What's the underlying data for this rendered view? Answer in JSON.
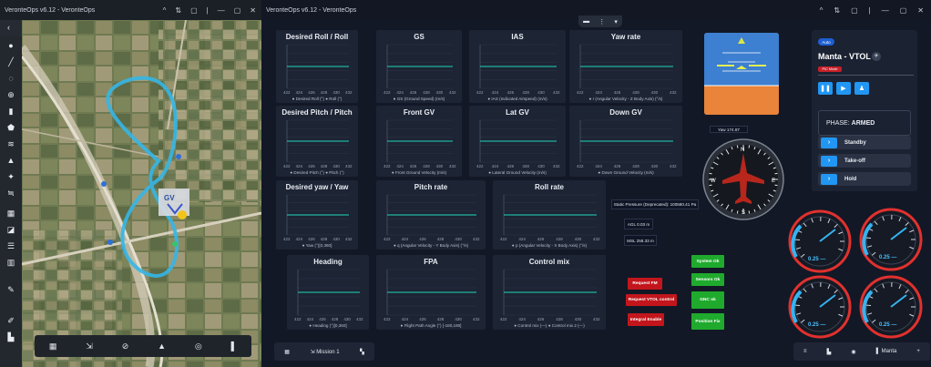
{
  "map_window": {
    "title": "VeronteOps v6.12 - VeronteOps",
    "controls": [
      "^",
      "⇅",
      "▢",
      "|",
      "—",
      "▢",
      "✕"
    ],
    "toolbar": [
      "‹",
      "▬",
      "⋮",
      "▾"
    ],
    "sidebar_icons": [
      "location-pin",
      "ruler",
      "lasso",
      "globe",
      "phone",
      "shape",
      "layers",
      "warning",
      "pin",
      "route",
      "grid",
      "edit",
      "list",
      "trash",
      "pencil",
      "pen",
      "bin"
    ],
    "bottombar": [
      "▦",
      "⇲",
      "⊘",
      "▲",
      "◎",
      "▌"
    ],
    "track_color": "#35b6e6"
  },
  "main_window": {
    "title": "VeronteOps v6.12 - VeronteOps",
    "controls": [
      "^",
      "⇅",
      "▢",
      "|",
      "—",
      "▢",
      "✕"
    ],
    "top_pill": [
      "▬",
      "⋮",
      "▾"
    ]
  },
  "panels": [
    {
      "title": "Desired Roll / Roll",
      "legend": [
        "Desired Roll (°)",
        "Roll (°)"
      ]
    },
    {
      "title": "GS",
      "legend": [
        "GS (Ground Speed) (m/s)"
      ]
    },
    {
      "title": "IAS",
      "legend": [
        "IAS (Indicated Airspeed) (m/s)"
      ]
    },
    {
      "title": "Yaw rate",
      "legend": [
        "r (Angular Velocity - Z Body Axis) (°/s)"
      ]
    },
    {
      "title": "Desired Pitch / Pitch",
      "legend": [
        "Desired Pitch (°)",
        "Pitch (°)"
      ]
    },
    {
      "title": "Front GV",
      "legend": [
        "Front Ground Velocity (m/s)"
      ]
    },
    {
      "title": "Lat GV",
      "legend": [
        "Lateral Ground Velocity (m/s)"
      ]
    },
    {
      "title": "Down GV",
      "legend": [
        "Down Ground Velocity (m/s)"
      ]
    },
    {
      "title": "Desired yaw / Yaw",
      "legend": [
        "Yaw (°)[0,360]"
      ]
    },
    {
      "title": "Pitch rate",
      "legend": [
        "q (Angular Velocity - Y Body Axis) (°/s)"
      ]
    },
    {
      "title": "Roll rate",
      "legend": [
        "p (Angular Velocity - X Body Axis) (°/s)"
      ]
    },
    {
      "title": "Heading",
      "legend": [
        "Heading (°)[0,360]"
      ]
    },
    {
      "title": "FPA",
      "legend": [
        "Flight Path Angle (°) [-180,180]"
      ]
    },
    {
      "title": "Control mix",
      "legend": [
        "Control mix (—)",
        "Control mix 2 (—)"
      ]
    }
  ],
  "x_ticks": [
    "422",
    "424",
    "426",
    "428",
    "430",
    "432"
  ],
  "info": {
    "yaw": "Yaw 174.87",
    "static_pressure": "Static Pressure (Deprecated): 100580.41 Pa",
    "agl": "AGL 0.03 m",
    "msl": "MSL 258.33 m"
  },
  "status_buttons": {
    "red": [
      "Request FM",
      "Request VTOL control",
      "Integral Enable"
    ],
    "green": [
      "System Ok",
      "Sensors Ok",
      "GNC ok",
      "Position Fix"
    ]
  },
  "vehicle": {
    "badge": "Auto",
    "name": "Manta - VTOL",
    "mode_tag": "PIC Mode",
    "phase_label": "PHASE:",
    "phase_value": "ARMED",
    "actions": [
      "Standby",
      "Take-off",
      "Hold"
    ]
  },
  "gauges": [
    "0.25 —",
    "0.25 —",
    "0.25 —",
    "0.25 —"
  ],
  "main_bottombar": {
    "mission": "Mission 1"
  },
  "right_bottombar": {
    "vehicle": "Manta"
  },
  "colors": {
    "panel_bg": "#1d2434",
    "series_primary": "#4aa3ff",
    "series_secondary": "#1fd6b8",
    "sky": "#3d7fd1",
    "ground": "#e9843a",
    "gauge_ring": "#e0312e"
  }
}
